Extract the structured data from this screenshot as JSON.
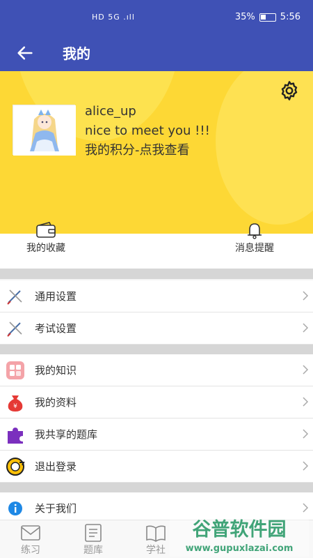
{
  "statusbar": {
    "center_icons": "HD 5G .ıll",
    "battery": "35%",
    "time": "5:56"
  },
  "appbar": {
    "title": "我的",
    "back_icon": "back-arrow-icon"
  },
  "profile": {
    "username": "alice_up",
    "greeting": "nice to meet you !!!",
    "points_link": "我的积分-点我查看",
    "settings_icon": "gear-icon",
    "accent": "#fdd835"
  },
  "quick_actions": [
    {
      "label": "我的收藏",
      "icon": "wallet-icon"
    },
    {
      "label": "消息提醒",
      "icon": "bell-icon"
    }
  ],
  "menu_group1": [
    {
      "label": "通用设置",
      "icon": "pen-tools-icon"
    },
    {
      "label": "考试设置",
      "icon": "pen-tools-icon"
    }
  ],
  "menu_group2": [
    {
      "label": "我的知识",
      "icon": "grid-icon"
    },
    {
      "label": "我的资料",
      "icon": "money-bag-icon"
    },
    {
      "label": "我共享的题库",
      "icon": "puzzle-icon"
    },
    {
      "label": "退出登录",
      "icon": "logout-icon"
    }
  ],
  "menu_group3": [
    {
      "label": "关于我们",
      "icon": "info-icon"
    }
  ],
  "tabs": [
    {
      "label": "练习",
      "icon": "envelope-icon"
    },
    {
      "label": "题库",
      "icon": "document-icon"
    },
    {
      "label": "学社",
      "icon": "book-icon"
    }
  ],
  "watermark": {
    "title": "谷普软件园",
    "url": "www.gupuxlazai.com"
  }
}
